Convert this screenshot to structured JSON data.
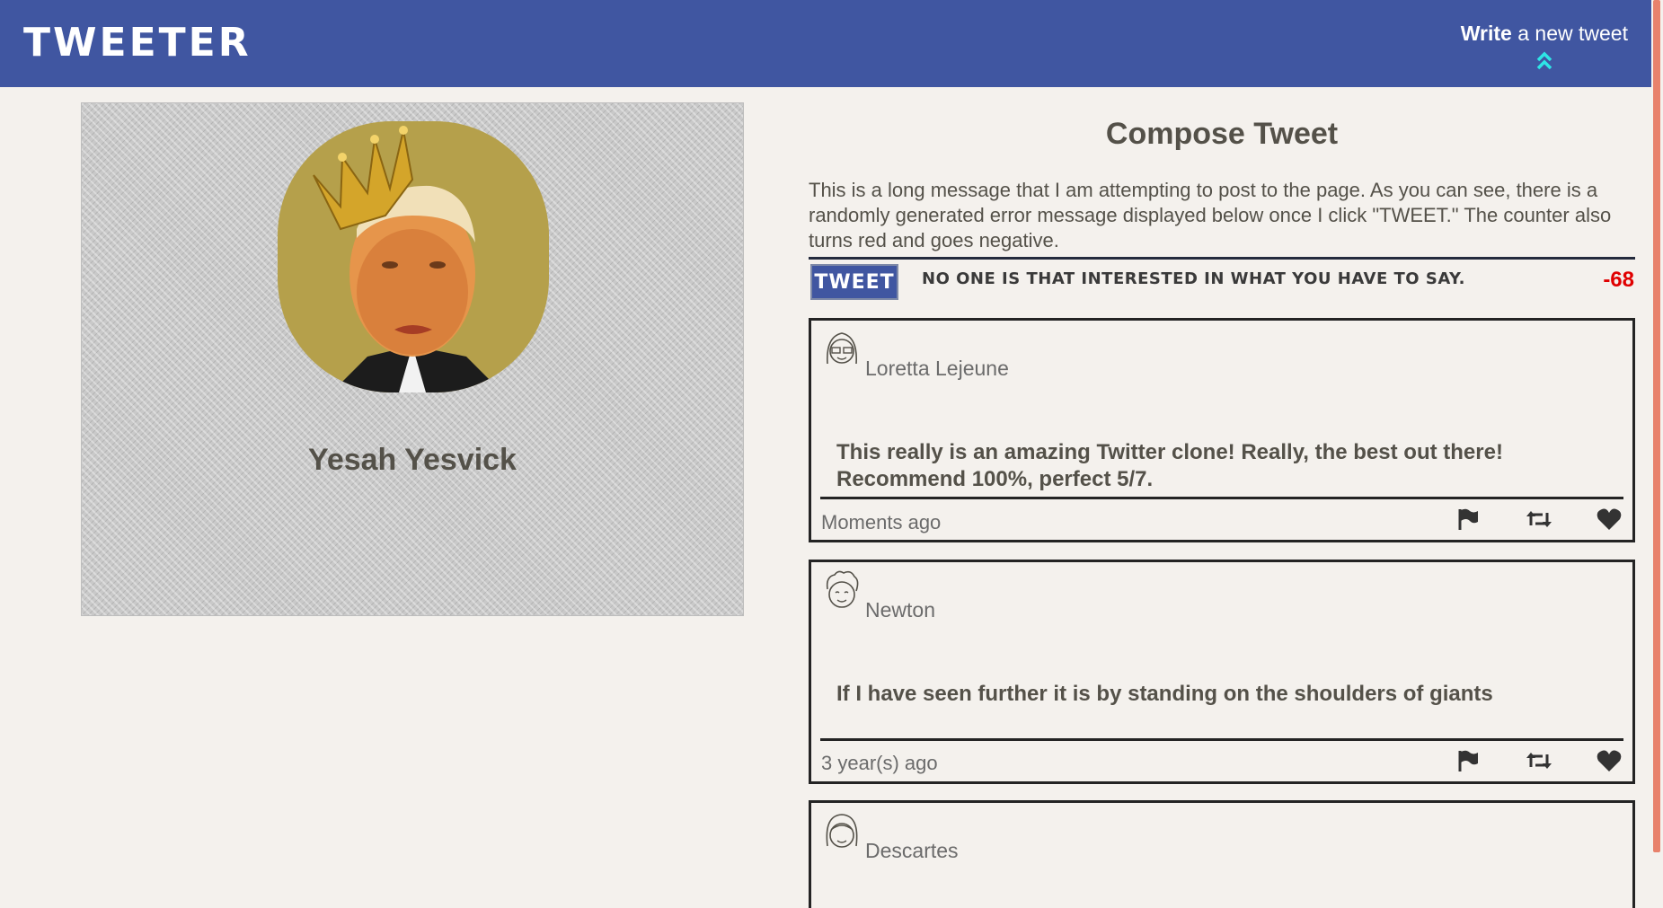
{
  "nav": {
    "brand": "TWEETER",
    "write_bold": "Write",
    "write_rest": " a new tweet"
  },
  "profile": {
    "name": "Yesah Yesvick"
  },
  "compose": {
    "title": "Compose Tweet",
    "text": "This is a long message that I am attempting to post to the page. As you can see, there is a randomly generated error message displayed below once I click \"TWEET.\" The counter also turns red and goes negative.",
    "button_label": "TWEET",
    "error": "NO ONE IS THAT INTERESTED IN WHAT YOU HAVE TO SAY.",
    "counter": "-68"
  },
  "tweets": [
    {
      "name": "Loretta Lejeune",
      "body": "This really is an amazing Twitter clone! Really, the best out there! Recommend 100%, perfect 5/7.",
      "time": "Moments ago"
    },
    {
      "name": "Newton",
      "body": "If I have seen further it is by standing on the shoulders of giants",
      "time": "3 year(s) ago"
    },
    {
      "name": "Descartes",
      "body": "",
      "time": ""
    }
  ],
  "colors": {
    "nav_bg": "#4056a1",
    "page_bg": "#f4f1ed",
    "counter_negative": "#e00000",
    "avatar_bg": "#b5a04b"
  },
  "icons": [
    "chevron-double-up-icon",
    "flag-icon",
    "retweet-icon",
    "heart-icon"
  ]
}
